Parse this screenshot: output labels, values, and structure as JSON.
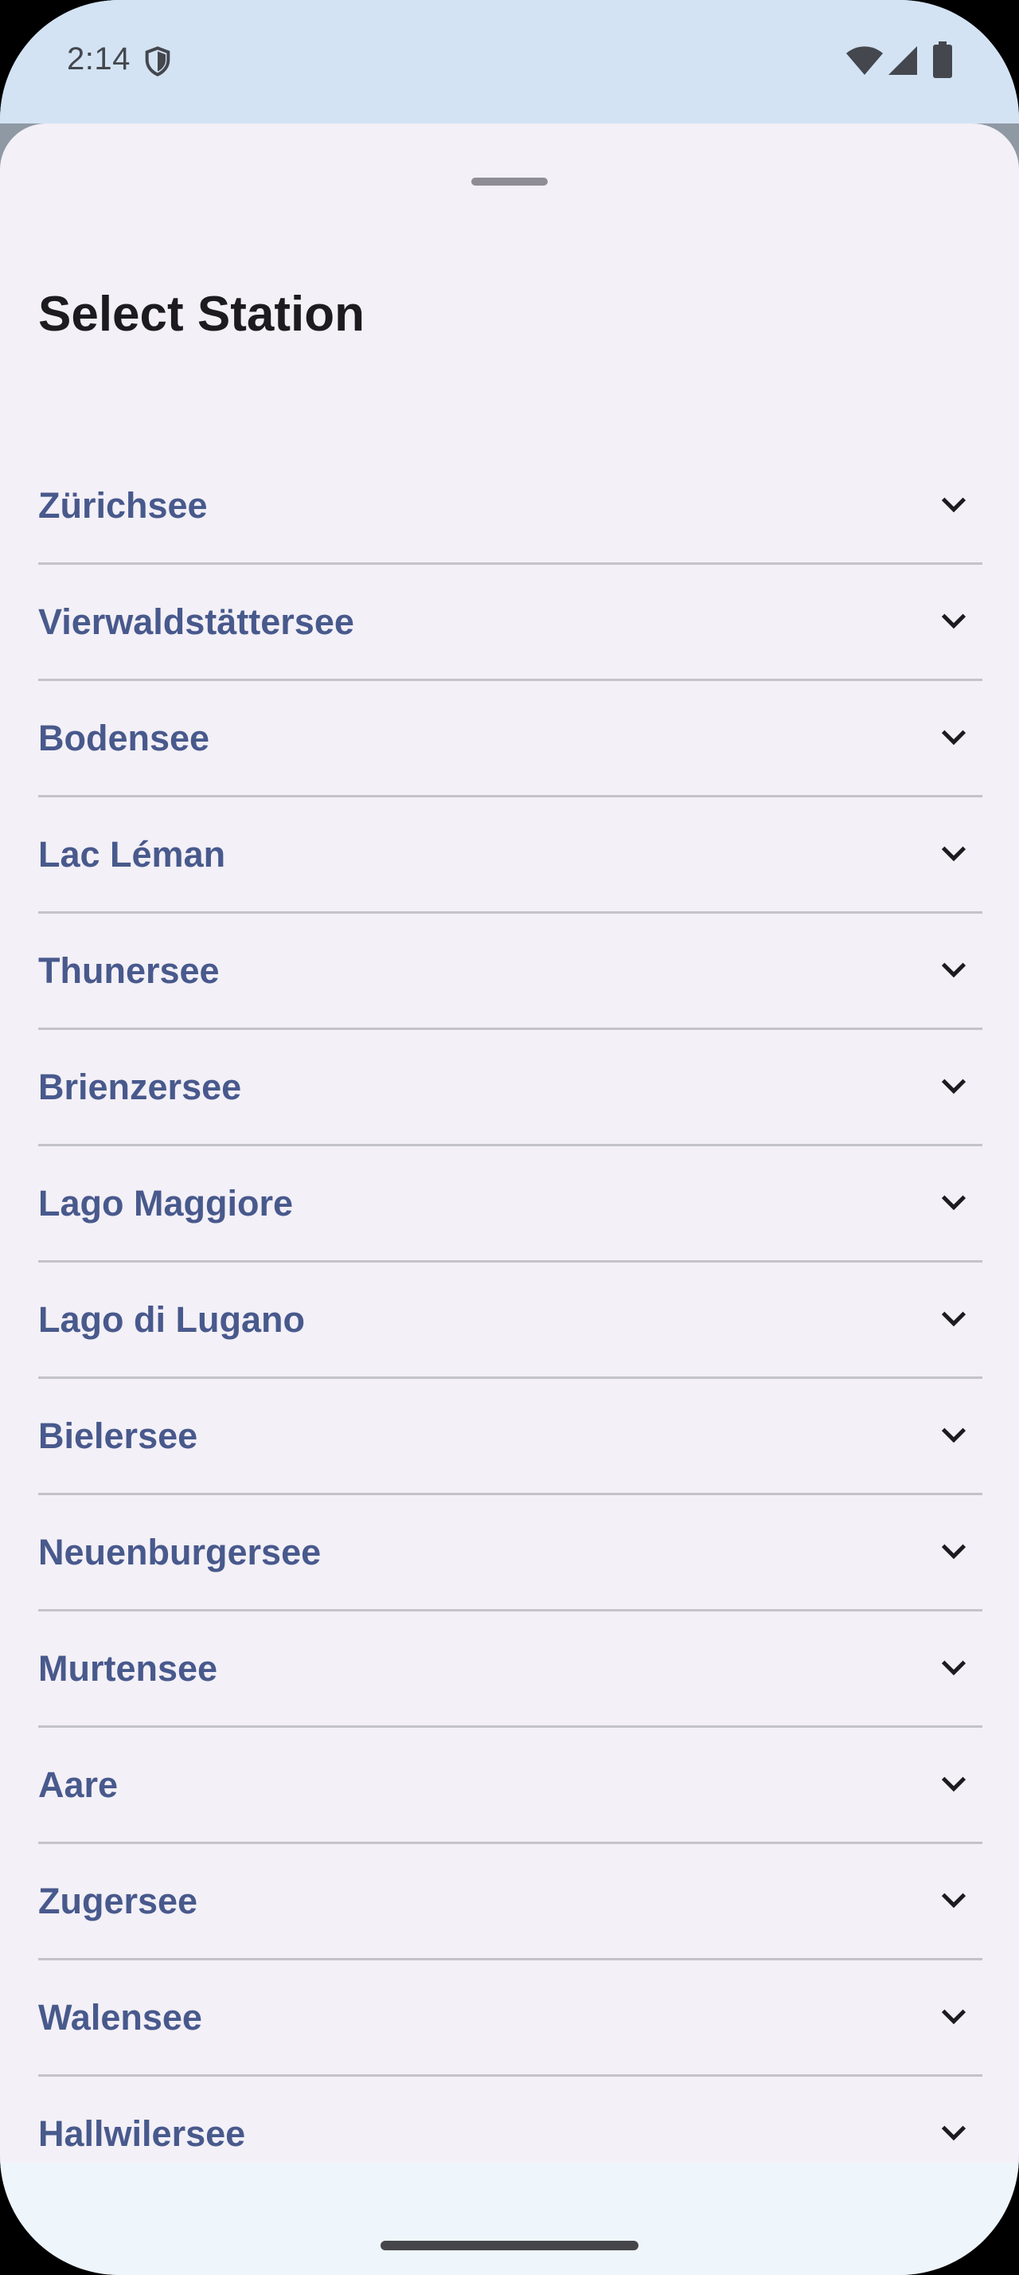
{
  "status_bar": {
    "time": "2:14",
    "icons": [
      "shield-icon",
      "wifi-icon",
      "signal-icon",
      "battery-icon"
    ]
  },
  "sheet": {
    "title": "Select Station",
    "stations": [
      {
        "label": "Zürichsee"
      },
      {
        "label": "Vierwaldstättersee"
      },
      {
        "label": "Bodensee"
      },
      {
        "label": "Lac Léman"
      },
      {
        "label": "Thunersee"
      },
      {
        "label": "Brienzersee"
      },
      {
        "label": "Lago Maggiore"
      },
      {
        "label": "Lago di Lugano"
      },
      {
        "label": "Bielersee"
      },
      {
        "label": "Neuenburgersee"
      },
      {
        "label": "Murtensee"
      },
      {
        "label": "Aare"
      },
      {
        "label": "Zugersee"
      },
      {
        "label": "Walensee"
      },
      {
        "label": "Hallwilersee"
      }
    ]
  },
  "colors": {
    "status_bar_bg": "#d3e3f3",
    "sheet_bg": "#f3f0f7",
    "station_text": "#48598c",
    "title_text": "#1c1b1f",
    "divider": "#c4c3c9"
  }
}
